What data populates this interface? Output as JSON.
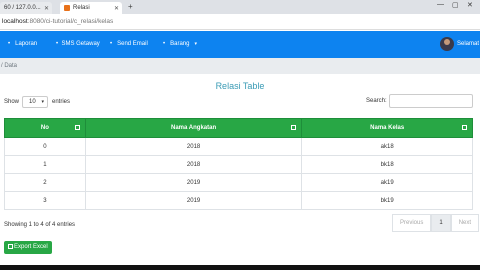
{
  "browser": {
    "tabs": [
      {
        "label": "60 / 127.0.0..."
      },
      {
        "label": "Relasi"
      }
    ],
    "url_host": "localhost",
    "url_path": ":8080/ci-tutorial/c_relasi/kelas"
  },
  "navbar": {
    "items": [
      {
        "label": "Laporan"
      },
      {
        "label": "SMS Getaway"
      },
      {
        "label": "Send Email"
      },
      {
        "label": "Barang"
      }
    ],
    "user": "Selamat"
  },
  "breadcrumb": "/ Data",
  "page_title": "Relasi Table",
  "table_controls": {
    "show_label": "Show",
    "entries_value": "10",
    "entries_label": "entries",
    "search_label": "Search:"
  },
  "table": {
    "headers": [
      "No",
      "Nama Angkatan",
      "Nama Kelas"
    ],
    "rows": [
      [
        "0",
        "2018",
        "ak18"
      ],
      [
        "1",
        "2018",
        "bk18"
      ],
      [
        "2",
        "2019",
        "ak19"
      ],
      [
        "3",
        "2019",
        "bk19"
      ]
    ]
  },
  "info_text": "Showing 1 to 4 of 4 entries",
  "pagination": {
    "previous": "Previous",
    "page": "1",
    "next": "Next"
  },
  "export_label": "Export Excel",
  "colors": {
    "navbar": "#0d83f0",
    "table_header": "#28a745",
    "title": "#3a9bb5"
  }
}
